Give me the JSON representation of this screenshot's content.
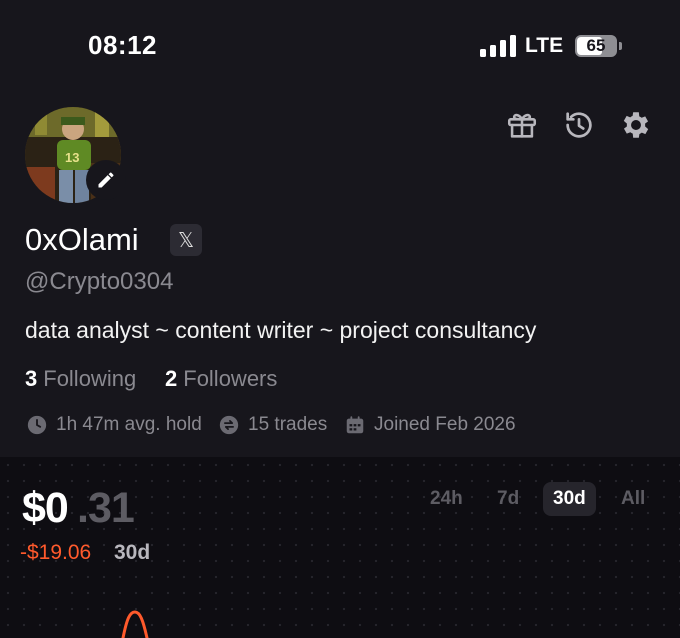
{
  "status_bar": {
    "time": "08:12",
    "network": "LTE",
    "battery_level": "65",
    "battery_fraction": 0.65
  },
  "header": {
    "icons": [
      "gift-icon",
      "history-icon",
      "settings-icon"
    ]
  },
  "profile": {
    "display_name": "0xOlami",
    "social_badge": "𝕏",
    "handle": "@Crypto0304",
    "bio": "data analyst ~ content writer ~ project consultancy",
    "following_count": "3",
    "following_label": "Following",
    "followers_count": "2",
    "followers_label": "Followers",
    "avg_hold": "1h 47m avg. hold",
    "trades": "15 trades",
    "joined": "Joined Feb 2026"
  },
  "portfolio": {
    "balance_int": "$0",
    "balance_dec": ".31",
    "pnl": "-$19.06",
    "pnl_period": "30d",
    "ranges": [
      "24h",
      "7d",
      "30d",
      "All"
    ],
    "active_range": "30d"
  },
  "colors": {
    "background": "#17161c",
    "panel": "#0e0d12",
    "muted_text": "#8a8990",
    "loss": "#ff5a2c"
  }
}
